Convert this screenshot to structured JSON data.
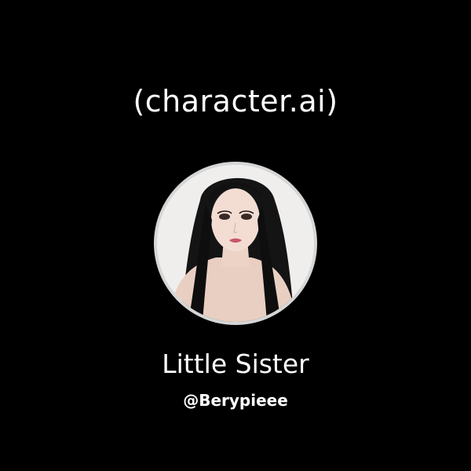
{
  "card": {
    "app_title": "(character.ai)",
    "character_name": "Little Sister",
    "creator_handle": "@Berypieee"
  },
  "avatar": {
    "icon": "character-avatar-portrait",
    "ring_color": "#d6d6d6",
    "background_color": "#efeeec"
  },
  "theme": {
    "background": "#000000",
    "text": "#ffffff"
  }
}
